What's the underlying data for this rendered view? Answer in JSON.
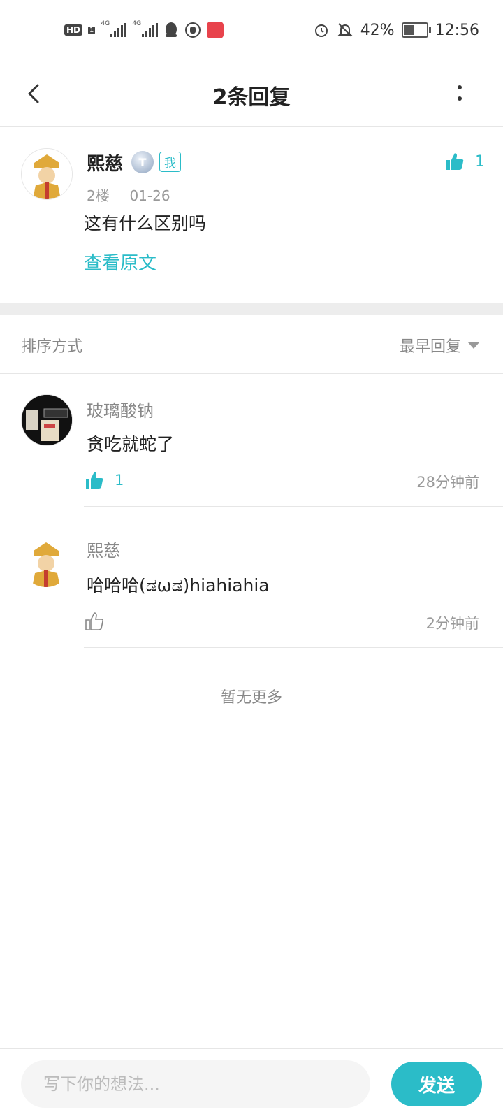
{
  "status_bar": {
    "hd": "HD",
    "sim": "1",
    "net1": "4G",
    "net2": "4G",
    "battery_pct": "42%",
    "battery_level": 0.42,
    "time": "12:56",
    "icons": [
      "qq-icon",
      "hand-icon",
      "huawei-app-icon",
      "alarm-icon",
      "bell-off-icon",
      "battery-icon"
    ]
  },
  "header": {
    "title": "2条回复"
  },
  "post": {
    "author": "熙慈",
    "level": "T",
    "me_badge": "我",
    "floor": "2楼",
    "date": "01-26",
    "text": "这有什么区别吗",
    "view_original": "查看原文",
    "likes": "1"
  },
  "sort": {
    "label": "排序方式",
    "value": "最早回复"
  },
  "replies": [
    {
      "author": "玻璃酸钠",
      "text": "贪吃就蛇了",
      "likes": "1",
      "time": "28分钟前"
    },
    {
      "author": "熙慈",
      "text": "哈哈哈(ಡωಡ)hiahiahia",
      "likes": "",
      "time": "2分钟前"
    }
  ],
  "no_more": "暂无更多",
  "composer": {
    "placeholder": "写下你的想法...",
    "send": "发送"
  },
  "colors": {
    "accent": "#2bbcc8",
    "text": "#222222",
    "muted": "#999999"
  }
}
